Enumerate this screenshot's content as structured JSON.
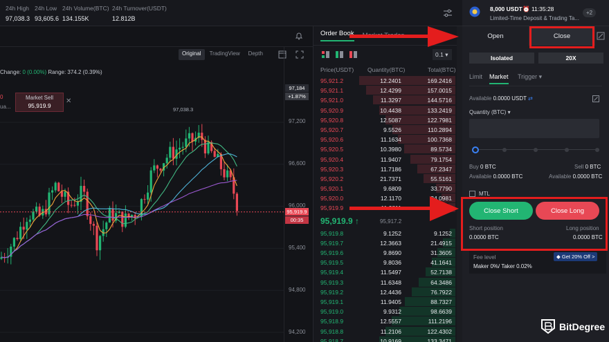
{
  "stats": [
    {
      "label": "24h High",
      "value": "97,038.3"
    },
    {
      "label": "24h Low",
      "value": "93,605.6"
    },
    {
      "label": "24h Volume(BTC)",
      "value": "134.155K"
    },
    {
      "label": "24h Turnover(USDT)",
      "value": "12.812B"
    }
  ],
  "chart": {
    "view_tabs": [
      "Original",
      "TradingView",
      "Depth"
    ],
    "info_change_label": "Change:",
    "info_change_value": "0 (0.00%)",
    "info_range": "Range: 374.2 (0.39%)",
    "market_sell_title": "Market Sell",
    "market_sell_value": "95,919.9",
    "left_partial_a": "0",
    "left_partial_b": "ua...",
    "high_label": "97,038.3",
    "axis_labels": [
      "97,200",
      "96,600",
      "96,000",
      "95,400",
      "94,800",
      "94,200"
    ],
    "top_tag_a": "97,184",
    "top_tag_b": "+1.87%",
    "price_tag": "95,919.9",
    "countdown_tag": "00:35"
  },
  "orderbook": {
    "tabs": [
      "Order Book",
      "Market Trades"
    ],
    "precision": "0.1",
    "headers": [
      "Price(USDT)",
      "Quantity(BTC)",
      "Total(BTC)"
    ],
    "asks": [
      {
        "p": "95,921.2",
        "q": "12.2401",
        "t": "169.2416"
      },
      {
        "p": "95,921.1",
        "q": "12.4299",
        "t": "157.0015"
      },
      {
        "p": "95,921.0",
        "q": "11.3297",
        "t": "144.5716"
      },
      {
        "p": "95,920.9",
        "q": "10.4438",
        "t": "133.2419"
      },
      {
        "p": "95,920.8",
        "q": "12.5087",
        "t": "122.7981"
      },
      {
        "p": "95,920.7",
        "q": "9.5526",
        "t": "110.2894"
      },
      {
        "p": "95,920.6",
        "q": "11.1634",
        "t": "100.7368"
      },
      {
        "p": "95,920.5",
        "q": "10.3980",
        "t": "89.5734"
      },
      {
        "p": "95,920.4",
        "q": "11.9407",
        "t": "79.1754"
      },
      {
        "p": "95,920.3",
        "q": "11.7186",
        "t": "67.2347"
      },
      {
        "p": "95,920.2",
        "q": "21.7371",
        "t": "55.5161"
      },
      {
        "p": "95,920.1",
        "q": "9.6809",
        "t": "33.7790"
      },
      {
        "p": "95,920.0",
        "q": "12.1170",
        "t": "24.0981"
      },
      {
        "p": "95,919.9",
        "q": "11.9811",
        "t": "11.9811"
      }
    ],
    "mid_price": "95,919.9 ↑",
    "mid_mark": "95,917.2",
    "bids": [
      {
        "p": "95,919.8",
        "q": "9.1252",
        "t": "9.1252"
      },
      {
        "p": "95,919.7",
        "q": "12.3663",
        "t": "21.4915"
      },
      {
        "p": "95,919.6",
        "q": "9.8690",
        "t": "31.3605"
      },
      {
        "p": "95,919.5",
        "q": "9.8036",
        "t": "41.1641"
      },
      {
        "p": "95,919.4",
        "q": "11.5497",
        "t": "52.7138"
      },
      {
        "p": "95,919.3",
        "q": "11.6348",
        "t": "64.3486"
      },
      {
        "p": "95,919.2",
        "q": "12.4436",
        "t": "76.7922"
      },
      {
        "p": "95,919.1",
        "q": "11.9405",
        "t": "88.7327"
      },
      {
        "p": "95,919.0",
        "q": "9.9312",
        "t": "98.6639"
      },
      {
        "p": "95,918.9",
        "q": "12.5557",
        "t": "111.2196"
      },
      {
        "p": "95,918.8",
        "q": "11.2106",
        "t": "122.4302"
      },
      {
        "p": "95,918.7",
        "q": "10.9169",
        "t": "133.3471"
      }
    ]
  },
  "trade": {
    "promo_amount": "8,000 USDT",
    "promo_timer": "11:35:28",
    "promo_subtitle": "Limited-Time Deposit & Trading Ta...",
    "promo_count": "+2",
    "open_tab": "Open",
    "close_tab": "Close",
    "margin_mode": "Isolated",
    "leverage": "20X",
    "order_types": [
      "Limit",
      "Market",
      "Trigger ▾"
    ],
    "available_label": "Available",
    "available_value": "0.0000 USDT",
    "quantity_label": "Quantity (BTC) ▾",
    "buy_label": "Buy",
    "buy_value": "0 BTC",
    "sell_label": "Sell",
    "sell_value": "0 BTC",
    "avail_left_label": "Available",
    "avail_left_value": "0.0000 BTC",
    "avail_right_label": "Available",
    "avail_right_value": "0.0000 BTC",
    "mtl": "MTL",
    "close_short": "Close Short",
    "close_long": "Close Long",
    "short_pos_label": "Short position",
    "short_pos_value": "0.0000 BTC",
    "long_pos_label": "Long position",
    "long_pos_value": "0.0000 BTC",
    "fee_label": "Fee level",
    "fee_value": "Maker 0%/ Taker 0.02%",
    "fee_badge": "Get 20% Off >"
  },
  "watermark": "BitDegree",
  "colors": {
    "accent_green": "#22b573",
    "accent_red": "#e84855",
    "annotation_red": "#e41d1d"
  }
}
